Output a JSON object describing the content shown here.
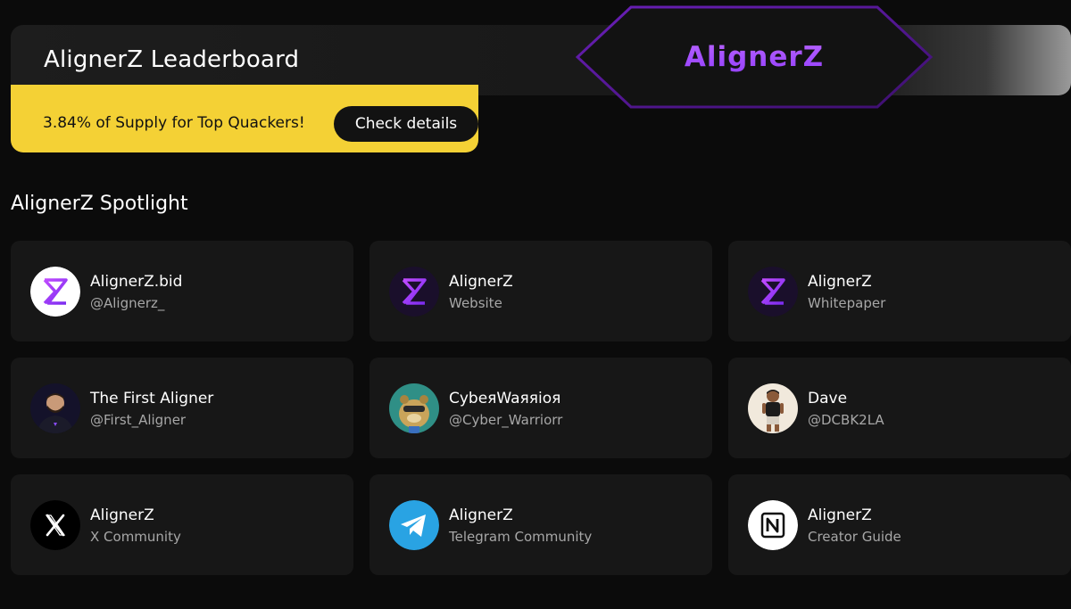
{
  "header": {
    "title": "AlignerZ Leaderboard",
    "logo_text": "AlignerZ"
  },
  "promo": {
    "text": "3.84% of Supply for Top Quackers!",
    "button_label": "Check details"
  },
  "spotlight": {
    "title": "AlignerZ Spotlight",
    "cards": [
      {
        "name": "AlignerZ.bid",
        "sub": "@Alignerz_",
        "icon": "alignerz-logo-icon"
      },
      {
        "name": "AlignerZ",
        "sub": "Website",
        "icon": "alignerz-logo-icon"
      },
      {
        "name": "AlignerZ",
        "sub": "Whitepaper",
        "icon": "alignerz-logo-icon"
      },
      {
        "name": "The First Aligner",
        "sub": "@First_Aligner",
        "icon": "profile-avatar"
      },
      {
        "name": "CybeяWaяяioя",
        "sub": "@Cyber_Warriorr",
        "icon": "profile-avatar"
      },
      {
        "name": "Dave",
        "sub": "@DCBK2LA",
        "icon": "profile-avatar"
      },
      {
        "name": "AlignerZ",
        "sub": "X Community",
        "icon": "x-logo-icon"
      },
      {
        "name": "AlignerZ",
        "sub": "Telegram Community",
        "icon": "telegram-icon"
      },
      {
        "name": "AlignerZ",
        "sub": "Creator Guide",
        "icon": "notion-icon"
      }
    ]
  },
  "colors": {
    "background": "#0b0b0b",
    "card": "#171717",
    "promo_yellow": "#f4d135",
    "brand_purple": "#a04bff"
  }
}
